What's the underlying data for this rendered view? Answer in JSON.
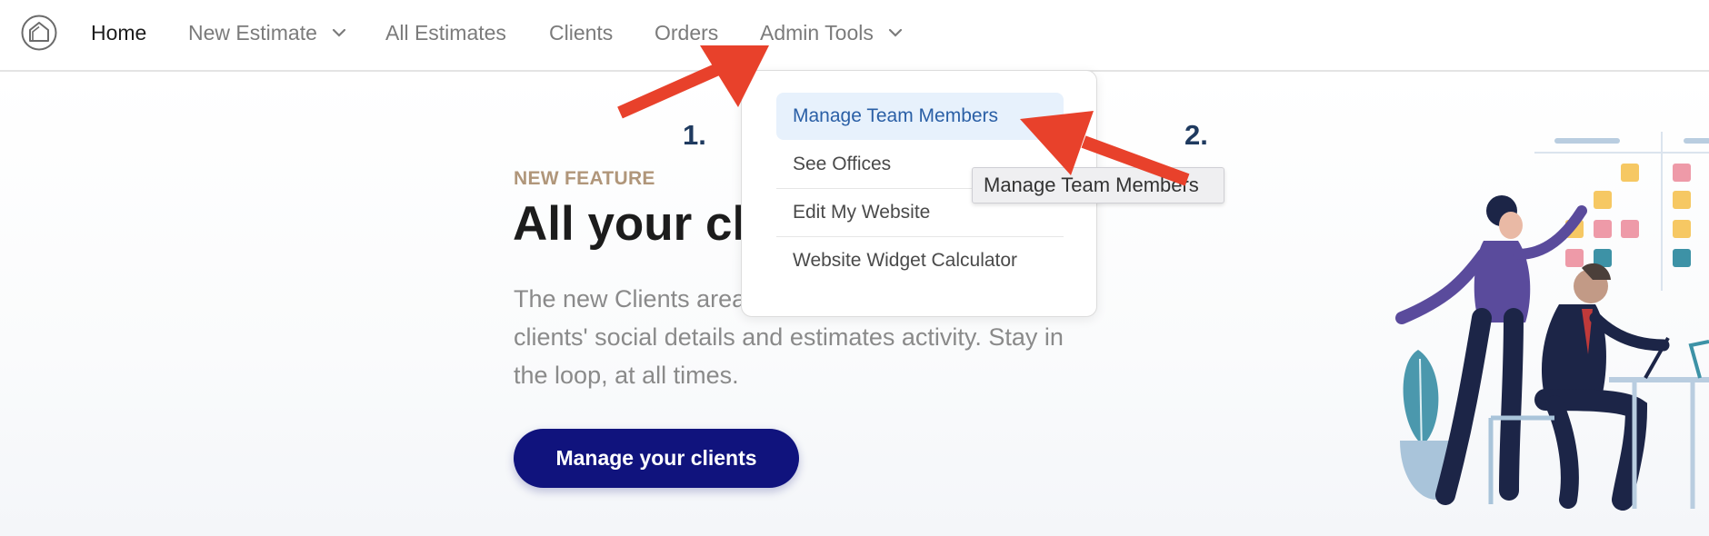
{
  "nav": {
    "logo_icon": "house-circle-icon",
    "items": [
      {
        "label": "Home",
        "active": true
      },
      {
        "label": "New Estimate",
        "has_dropdown": true
      },
      {
        "label": "All Estimates"
      },
      {
        "label": "Clients"
      },
      {
        "label": "Orders"
      },
      {
        "label": "Admin Tools",
        "has_dropdown": true
      }
    ]
  },
  "hero": {
    "eyebrow": "NEW FEATURE",
    "title": "All your clients",
    "body_line1": "The new Clients area",
    "body_line2": "clients' social details and estimates activity. Stay in",
    "body_line3": "the loop, at all times.",
    "cta_label": "Manage your clients"
  },
  "admin_dropdown": {
    "items": [
      {
        "label": "Manage Team Members",
        "selected": true
      },
      {
        "label": "See Offices"
      },
      {
        "label": "Edit My Website"
      },
      {
        "label": "Website Widget Calculator"
      }
    ]
  },
  "tooltip": {
    "text": "Manage Team Members"
  },
  "annotations": {
    "step1": "1.",
    "step2": "2."
  },
  "colors": {
    "primary_button": "#10137d",
    "eyebrow": "#b0967a",
    "selected_item_bg": "#e7f1fc",
    "selected_item_text": "#2a5fa6",
    "annotation_arrow": "#e8412b"
  }
}
